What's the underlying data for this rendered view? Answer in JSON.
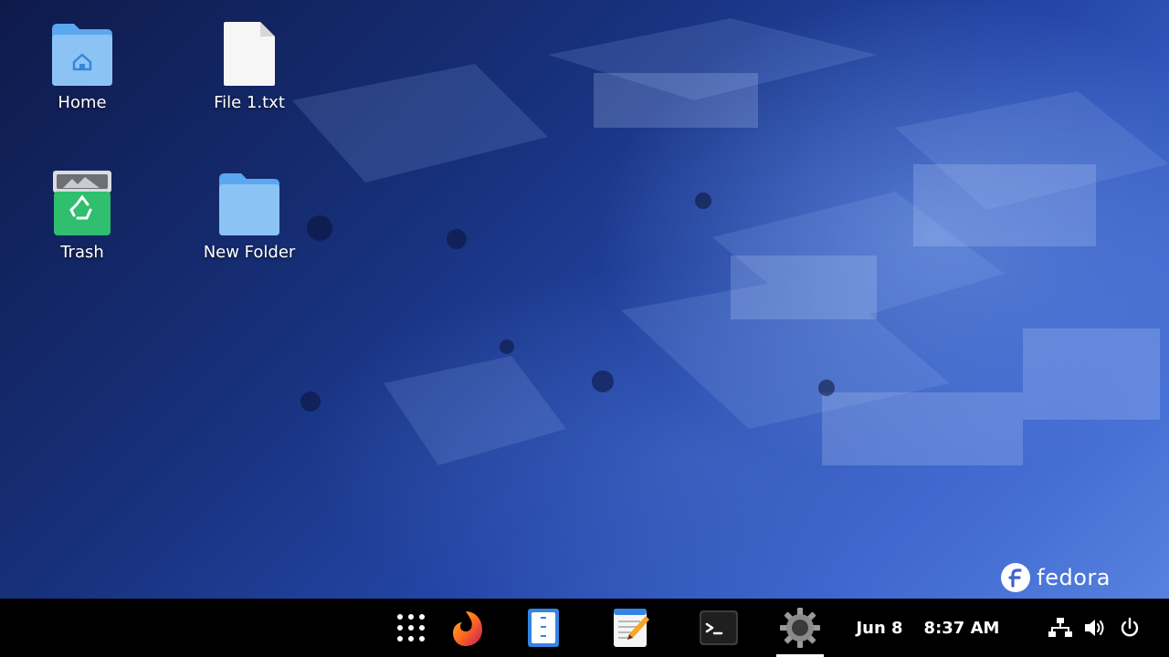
{
  "desktop": {
    "icons": [
      {
        "label": "Home"
      },
      {
        "label": "File 1.txt"
      },
      {
        "label": "Trash"
      },
      {
        "label": "New Folder"
      }
    ],
    "brand": {
      "name": "fedora"
    }
  },
  "taskbar": {
    "apps": [
      {
        "icon": "app-grid-icon"
      },
      {
        "icon": "firefox-icon"
      },
      {
        "icon": "file-manager-icon"
      },
      {
        "icon": "text-editor-icon"
      },
      {
        "icon": "terminal-icon"
      },
      {
        "icon": "settings-gear-icon",
        "active": true
      }
    ],
    "date": "Jun 8",
    "time": "8:37 AM",
    "tray": [
      {
        "icon": "network-icon"
      },
      {
        "icon": "volume-icon"
      },
      {
        "icon": "power-icon"
      }
    ]
  },
  "colors": {
    "folder": "#5aa8f0",
    "trash_green": "#2fbf6e",
    "taskbar_bg": "#000000",
    "desktop_accent": "#2446a8"
  }
}
